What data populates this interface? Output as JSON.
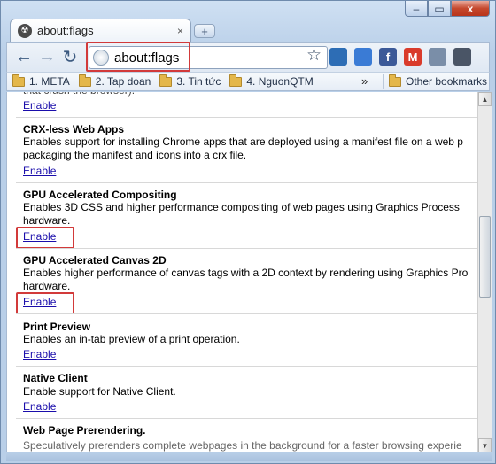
{
  "tab": {
    "title": "about:flags",
    "close": "×",
    "new_tab": "+"
  },
  "window_controls": {
    "minimize": "–",
    "maximize": "▭",
    "close": "x"
  },
  "toolbar": {
    "back": "←",
    "forward": "→",
    "reload": "↻",
    "url": "about:flags",
    "star": "☆",
    "extensions": [
      {
        "name": "picasa-icon",
        "label": "",
        "color": "#2d6db5"
      },
      {
        "name": "calendar-icon",
        "label": "",
        "color": "#3a7bd5"
      },
      {
        "name": "facebook-icon",
        "label": "f",
        "color": "#3b5998"
      },
      {
        "name": "gmail-icon",
        "label": "M",
        "color": "#d93b2b"
      },
      {
        "name": "page-menu-icon",
        "label": "",
        "color": "#7a8ea8"
      },
      {
        "name": "wrench-icon",
        "label": "",
        "color": "#4a5566"
      }
    ]
  },
  "bookmarks": {
    "items": [
      {
        "label": "1. META"
      },
      {
        "label": "2. Tap doan"
      },
      {
        "label": "3. Tin tức"
      },
      {
        "label": "4. NguonQTM"
      }
    ],
    "more": "»",
    "other": "Other bookmarks"
  },
  "experiments": [
    {
      "title": "",
      "desc": [],
      "link": "Enable"
    },
    {
      "title": "CRX-less Web Apps",
      "desc": [
        "Enables support for installing Chrome apps that are deployed using a manifest file on a web p",
        "packaging the manifest and icons into a crx file."
      ],
      "link": "Enable"
    },
    {
      "title": "GPU Accelerated Compositing",
      "desc": [
        "Enables 3D CSS and higher performance compositing of web pages using Graphics Process",
        "hardware."
      ],
      "link": "Enable"
    },
    {
      "title": "GPU Accelerated Canvas 2D",
      "desc": [
        "Enables higher performance of canvas tags with a 2D context by rendering using Graphics Pro",
        "hardware."
      ],
      "link": "Enable"
    },
    {
      "title": "Print Preview",
      "desc": [
        "Enables an in-tab preview of a print operation."
      ],
      "link": "Enable"
    },
    {
      "title": "Native Client",
      "desc": [
        "Enable support for Native Client."
      ],
      "link": "Enable"
    },
    {
      "title": "Web Page Prerendering.",
      "desc": [],
      "link": ""
    }
  ]
}
